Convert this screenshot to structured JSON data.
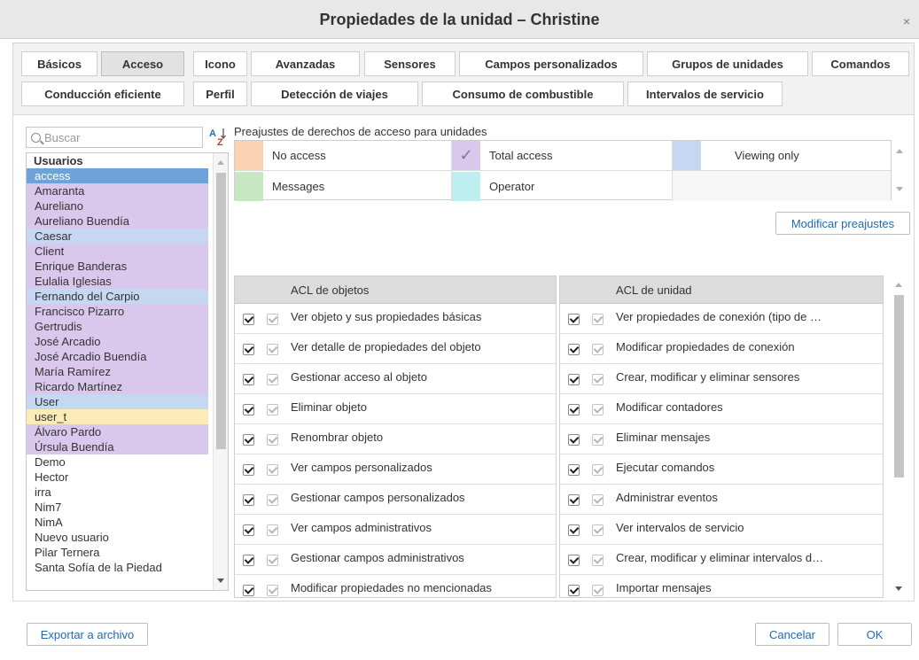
{
  "window": {
    "title": "Propiedades de la unidad – Christine",
    "close_label": "×"
  },
  "tabs": [
    {
      "label": "Básicos"
    },
    {
      "label": "Acceso"
    },
    {
      "label": "Icono"
    },
    {
      "label": "Avanzadas"
    },
    {
      "label": "Sensores"
    },
    {
      "label": "Campos personalizados"
    },
    {
      "label": "Grupos de unidades"
    },
    {
      "label": "Comandos"
    },
    {
      "label": "Conducción eficiente"
    },
    {
      "label": "Perfil"
    },
    {
      "label": "Detección de viajes"
    },
    {
      "label": "Consumo de combustible"
    },
    {
      "label": "Intervalos de servicio"
    }
  ],
  "active_tab": "Acceso",
  "search": {
    "placeholder": "Buscar"
  },
  "users": {
    "header": "Usuarios",
    "items": [
      {
        "name": "access",
        "state": "selected"
      },
      {
        "name": "Amaranta",
        "state": "purple"
      },
      {
        "name": "Aureliano",
        "state": "purple"
      },
      {
        "name": "Aureliano Buendía",
        "state": "purple"
      },
      {
        "name": "Caesar",
        "state": "blue"
      },
      {
        "name": "Client",
        "state": "purple"
      },
      {
        "name": "Enrique Banderas",
        "state": "purple"
      },
      {
        "name": "Eulalia Iglesias",
        "state": "purple"
      },
      {
        "name": "Fernando del Carpio",
        "state": "blue"
      },
      {
        "name": "Francisco Pizarro",
        "state": "purple"
      },
      {
        "name": "Gertrudis",
        "state": "purple"
      },
      {
        "name": "José Arcadio",
        "state": "purple"
      },
      {
        "name": "José Arcadio Buendía",
        "state": "purple"
      },
      {
        "name": "María Ramírez",
        "state": "purple"
      },
      {
        "name": "Ricardo Martínez",
        "state": "purple"
      },
      {
        "name": "User",
        "state": "blue"
      },
      {
        "name": "user_t",
        "state": "yellow"
      },
      {
        "name": "Álvaro Pardo",
        "state": "purple"
      },
      {
        "name": "Úrsula Buendía",
        "state": "purple"
      },
      {
        "name": "Demo",
        "state": "none"
      },
      {
        "name": "Hector",
        "state": "none"
      },
      {
        "name": "irra",
        "state": "none"
      },
      {
        "name": "Nim7",
        "state": "none"
      },
      {
        "name": "NimA",
        "state": "none"
      },
      {
        "name": "Nuevo usuario",
        "state": "none"
      },
      {
        "name": "Pilar Ternera",
        "state": "none"
      },
      {
        "name": "Santa Sofía de la Piedad",
        "state": "none"
      }
    ]
  },
  "presets": {
    "title": "Preajustes de derechos de acceso para unidades",
    "items": [
      {
        "label": "No access",
        "color": "#f9d2b4",
        "checked": false
      },
      {
        "label": "Total access",
        "color": "#d9c8ec",
        "checked": true
      },
      {
        "label": "Viewing  only",
        "color": "#c6d8f1",
        "checked": false
      },
      {
        "label": "Messages",
        "color": "#c7e6c2",
        "checked": false
      },
      {
        "label": "Operator",
        "color": "#bdeff0",
        "checked": false
      }
    ],
    "check_glyph": "✓",
    "modify_label": "Modificar preajustes"
  },
  "acl_objects": {
    "header": "ACL de objetos",
    "rows": [
      "Ver objeto y sus propiedades básicas",
      "Ver detalle de propiedades del objeto",
      "Gestionar acceso al objeto",
      "Eliminar objeto",
      "Renombrar objeto",
      "Ver campos personalizados",
      "Gestionar campos personalizados",
      "Ver campos administrativos",
      "Gestionar campos administrativos",
      "Modificar propiedades no mencionadas"
    ]
  },
  "acl_unit": {
    "header": "ACL de unidad",
    "rows": [
      "Ver propiedades de conexión (tipo de …",
      "Modificar propiedades de conexión",
      "Crear, modificar y eliminar sensores",
      "Modificar contadores",
      "Eliminar mensajes",
      "Ejecutar comandos",
      "Administrar eventos",
      "Ver intervalos de servicio",
      "Crear, modificar y eliminar intervalos d…",
      "Importar mensajes"
    ]
  },
  "footer": {
    "export_label": "Exportar a archivo",
    "cancel_label": "Cancelar",
    "ok_label": "OK"
  }
}
